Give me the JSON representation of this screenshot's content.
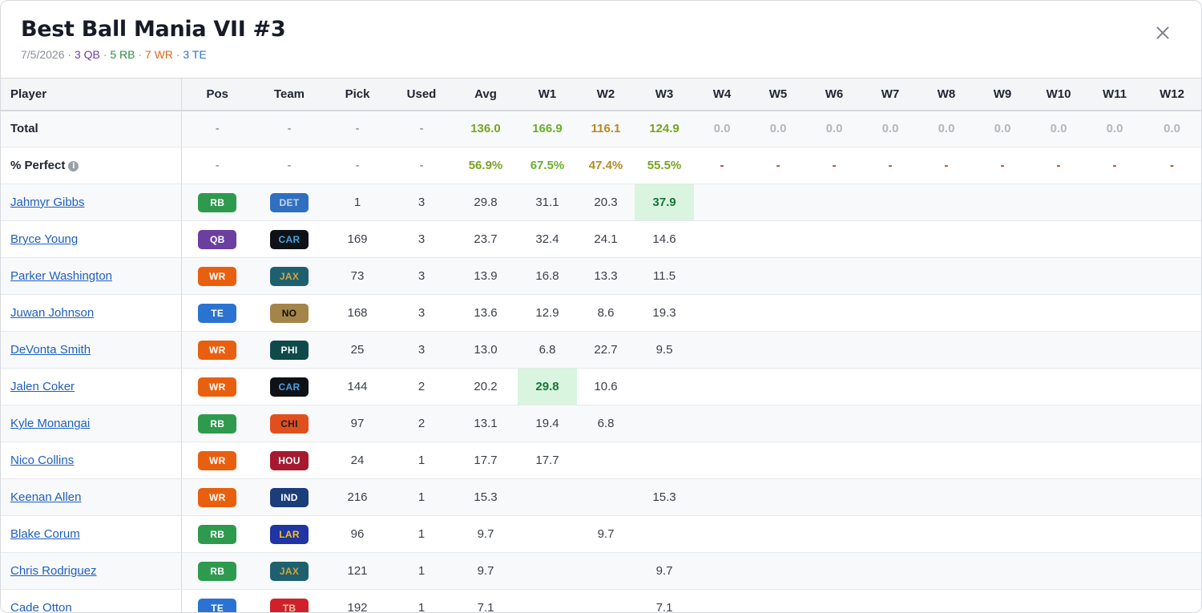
{
  "modal": {
    "title": "Best Ball Mania VII #3",
    "date": "7/5/2026",
    "sep": " · ",
    "qb_count": "3 QB",
    "rb_count": "5 RB",
    "wr_count": "7 WR",
    "te_count": "3 TE"
  },
  "table": {
    "headers": [
      "Player",
      "Pos",
      "Team",
      "Pick",
      "Used",
      "Avg",
      "W1",
      "W2",
      "W3",
      "W4",
      "W5",
      "W6",
      "W7",
      "W8",
      "W9",
      "W10",
      "W11",
      "W12"
    ],
    "total": {
      "label": "Total",
      "pos": "-",
      "team": "-",
      "pick": "-",
      "used": "-",
      "avg": "136.0",
      "weeks": [
        "166.9",
        "116.1",
        "124.9",
        "0.0",
        "0.0",
        "0.0",
        "0.0",
        "0.0",
        "0.0",
        "0.0",
        "0.0",
        "0.0"
      ]
    },
    "perfect": {
      "label": "% Perfect",
      "info_icon": "i",
      "pos": "-",
      "team": "-",
      "pick": "-",
      "used": "-",
      "avg": "56.9%",
      "weeks": [
        "67.5%",
        "47.4%",
        "55.5%",
        "-",
        "-",
        "-",
        "-",
        "-",
        "-",
        "-",
        "-",
        "-"
      ]
    },
    "players": [
      {
        "name": "Jahmyr Gibbs",
        "pos": "RB",
        "team": "DET",
        "pick": "1",
        "used": "3",
        "avg": "29.8",
        "weeks": [
          "31.1",
          "20.3",
          "37.9",
          "",
          "",
          "",
          "",
          "",
          "",
          "",
          "",
          ""
        ],
        "hl": 2
      },
      {
        "name": "Bryce Young",
        "pos": "QB",
        "team": "CAR",
        "pick": "169",
        "used": "3",
        "avg": "23.7",
        "weeks": [
          "32.4",
          "24.1",
          "14.6",
          "",
          "",
          "",
          "",
          "",
          "",
          "",
          "",
          ""
        ],
        "hl": -1
      },
      {
        "name": "Parker Washington",
        "pos": "WR",
        "team": "JAX",
        "pick": "73",
        "used": "3",
        "avg": "13.9",
        "weeks": [
          "16.8",
          "13.3",
          "11.5",
          "",
          "",
          "",
          "",
          "",
          "",
          "",
          "",
          ""
        ],
        "hl": -1
      },
      {
        "name": "Juwan Johnson",
        "pos": "TE",
        "team": "NO",
        "pick": "168",
        "used": "3",
        "avg": "13.6",
        "weeks": [
          "12.9",
          "8.6",
          "19.3",
          "",
          "",
          "",
          "",
          "",
          "",
          "",
          "",
          ""
        ],
        "hl": -1
      },
      {
        "name": "DeVonta Smith",
        "pos": "WR",
        "team": "PHI",
        "pick": "25",
        "used": "3",
        "avg": "13.0",
        "weeks": [
          "6.8",
          "22.7",
          "9.5",
          "",
          "",
          "",
          "",
          "",
          "",
          "",
          "",
          ""
        ],
        "hl": -1
      },
      {
        "name": "Jalen Coker",
        "pos": "WR",
        "team": "CAR",
        "pick": "144",
        "used": "2",
        "avg": "20.2",
        "weeks": [
          "29.8",
          "10.6",
          "",
          "",
          "",
          "",
          "",
          "",
          "",
          "",
          "",
          ""
        ],
        "hl": 0
      },
      {
        "name": "Kyle Monangai",
        "pos": "RB",
        "team": "CHI",
        "pick": "97",
        "used": "2",
        "avg": "13.1",
        "weeks": [
          "19.4",
          "6.8",
          "",
          "",
          "",
          "",
          "",
          "",
          "",
          "",
          "",
          ""
        ],
        "hl": -1
      },
      {
        "name": "Nico Collins",
        "pos": "WR",
        "team": "HOU",
        "pick": "24",
        "used": "1",
        "avg": "17.7",
        "weeks": [
          "17.7",
          "",
          "",
          "",
          "",
          "",
          "",
          "",
          "",
          "",
          "",
          ""
        ],
        "hl": -1
      },
      {
        "name": "Keenan Allen",
        "pos": "WR",
        "team": "IND",
        "pick": "216",
        "used": "1",
        "avg": "15.3",
        "weeks": [
          "",
          "",
          "15.3",
          "",
          "",
          "",
          "",
          "",
          "",
          "",
          "",
          ""
        ],
        "hl": -1
      },
      {
        "name": "Blake Corum",
        "pos": "RB",
        "team": "LAR",
        "pick": "96",
        "used": "1",
        "avg": "9.7",
        "weeks": [
          "",
          "9.7",
          "",
          "",
          "",
          "",
          "",
          "",
          "",
          "",
          "",
          ""
        ],
        "hl": -1
      },
      {
        "name": "Chris Rodriguez",
        "pos": "RB",
        "team": "JAX",
        "pick": "121",
        "used": "1",
        "avg": "9.7",
        "weeks": [
          "",
          "",
          "9.7",
          "",
          "",
          "",
          "",
          "",
          "",
          "",
          "",
          ""
        ],
        "hl": -1
      },
      {
        "name": "Cade Otton",
        "pos": "TE",
        "team": "TB",
        "pick": "192",
        "used": "1",
        "avg": "7.1",
        "weeks": [
          "",
          "",
          "7.1",
          "",
          "",
          "",
          "",
          "",
          "",
          "",
          "",
          ""
        ],
        "hl": -1
      }
    ]
  },
  "colors": {
    "pos": {
      "RB": "#2e9a4e",
      "QB": "#6b3fa0",
      "WR": "#e8600f",
      "TE": "#2b73d0"
    },
    "team_bg": {
      "DET": "#2f6fbf",
      "CAR": "#0e1116",
      "JAX": "#1e6070",
      "NO": "#a5844a",
      "PHI": "#0f4a4b",
      "CHI": "#e0501e",
      "HOU": "#a6192e",
      "IND": "#1b3d7a",
      "LAR": "#2034a3",
      "TB": "#d1202a"
    },
    "team_fg": {
      "DET": "#c9d6e6",
      "CAR": "#4aa3e0",
      "JAX": "#d4a43a",
      "NO": "#111111",
      "PHI": "#ffffff",
      "CHI": "#1a1f2c",
      "HOU": "#ffffff",
      "IND": "#ffffff",
      "LAR": "#f2c318",
      "TB": "#f7c6a0"
    },
    "week_total": [
      "tot-lime",
      "tot-olive",
      "tot-green"
    ]
  }
}
